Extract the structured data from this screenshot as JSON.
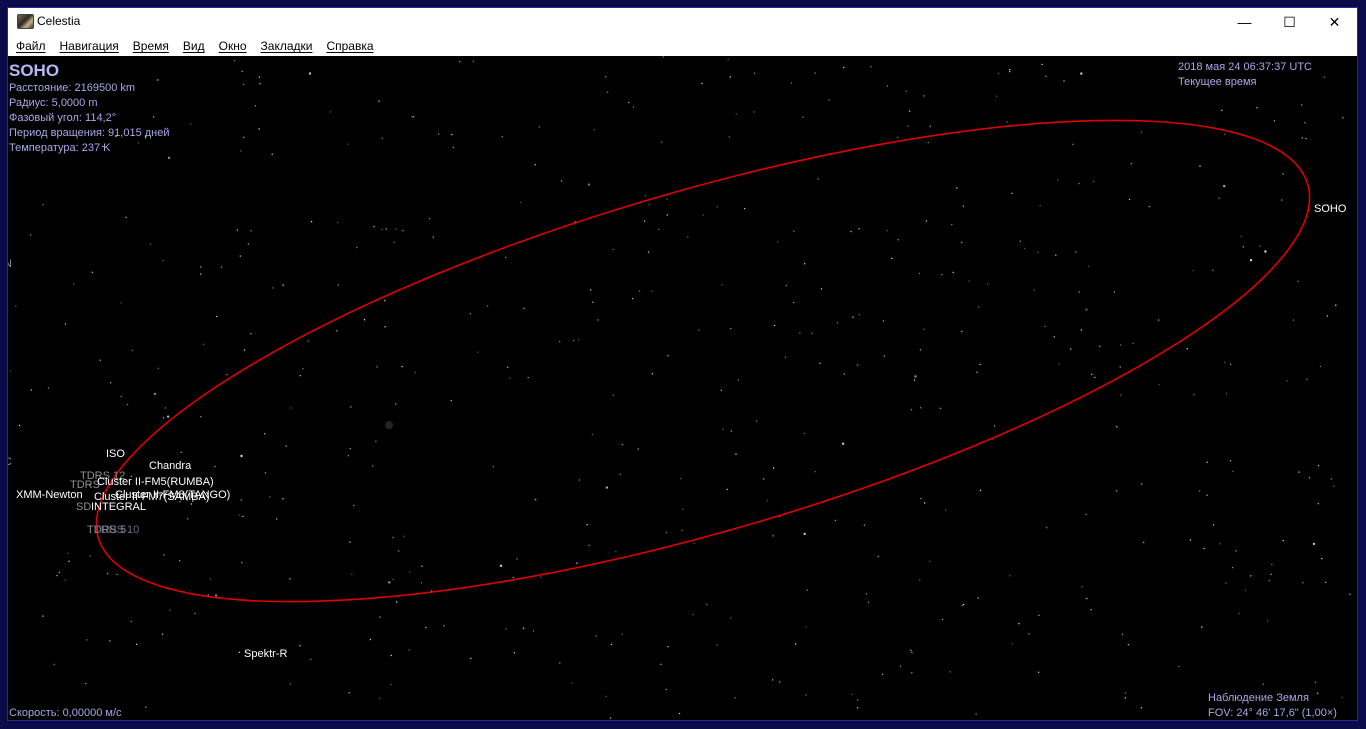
{
  "window": {
    "title": "Celestia",
    "icon": "celestia-app-icon",
    "controls": {
      "minimize": "—",
      "maximize": "☐",
      "close": "✕"
    }
  },
  "menu": [
    "Файл",
    "Навигация",
    "Время",
    "Вид",
    "Окно",
    "Закладки",
    "Справка"
  ],
  "info": {
    "object_name": "SOHO",
    "distance": "Расстояние: 2169500 km",
    "radius": "Радиус: 5,0000 m",
    "phase_angle": "Фазовый угол: 114,2°",
    "rotation_period": "Период вращения: 91,015 дней",
    "temperature": "Температура: 237 K"
  },
  "time": {
    "datetime": "2018 мая 24 06:37:37 UTC",
    "mode": "Текущее время"
  },
  "status": {
    "speed": "Скорость: 0,00000 м/с",
    "observer": "Наблюдение Земля",
    "fov": "FOV: 24° 46' 17,6\" (1,00×)"
  },
  "labels": {
    "soho": "SOHO",
    "iso": "ISO",
    "chandra": "Chandra",
    "tdrs12": "TDRS 12",
    "tdrs_partial": "TDRS",
    "cluster_rumba": "Cluster II-FM5(RUMBA)",
    "xmm": "XMM-Newton",
    "cluster_overlap": "Cluster II-FM7(SAMBA)",
    "cluster_tango": "Cluster II-FM8(TANGO)",
    "sd_partial": "SD",
    "integral": "INTEGRAL",
    "tdrs_a": "TDRS 5",
    "tdrs_b": "TDRS 10",
    "spektr": "Spektr-R",
    "edge_n": "N",
    "edge_c": "C"
  },
  "colors": {
    "orbit": "#e00000",
    "hud_text": "#a8a8e8",
    "background": "#000000"
  }
}
